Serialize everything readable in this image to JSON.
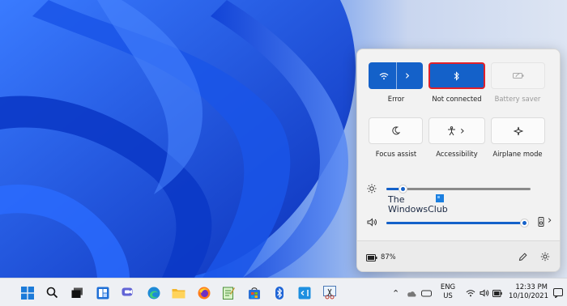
{
  "quick_settings": {
    "wifi": {
      "label": "Error",
      "icon": "wifi-icon",
      "arrow": "›"
    },
    "bluetooth": {
      "label": "Not connected",
      "icon": "bluetooth-icon"
    },
    "battery_saver": {
      "label": "Battery saver",
      "icon": "battery-saver-icon"
    },
    "focus_assist": {
      "label": "Focus assist",
      "icon": "moon-icon"
    },
    "accessibility": {
      "label": "Accessibility",
      "icon": "accessibility-icon",
      "arrow": "›"
    },
    "airplane_mode": {
      "label": "Airplane mode",
      "icon": "airplane-icon"
    },
    "brightness": {
      "level": 0.11
    },
    "volume": {
      "level": 0.97,
      "device_arrow": "›"
    },
    "battery": {
      "percent": "87%"
    }
  },
  "watermark": {
    "line1": "The",
    "line2": "WindowsClub"
  },
  "taskbar": {
    "apps": [
      "windows-start-icon",
      "search-icon",
      "task-view-icon",
      "widgets-icon",
      "chat-icon",
      "edge-icon",
      "file-explorer-icon",
      "firefox-icon",
      "notepad-icon",
      "store-icon",
      "bluetooth-icon",
      "vscode-icon",
      "snipping-icon"
    ],
    "language": "ENG",
    "region": "US",
    "time": "12:33 PM",
    "date": "10/10/2021"
  },
  "colors": {
    "accent": "#1461c9",
    "highlight_border": "#e0202a"
  }
}
